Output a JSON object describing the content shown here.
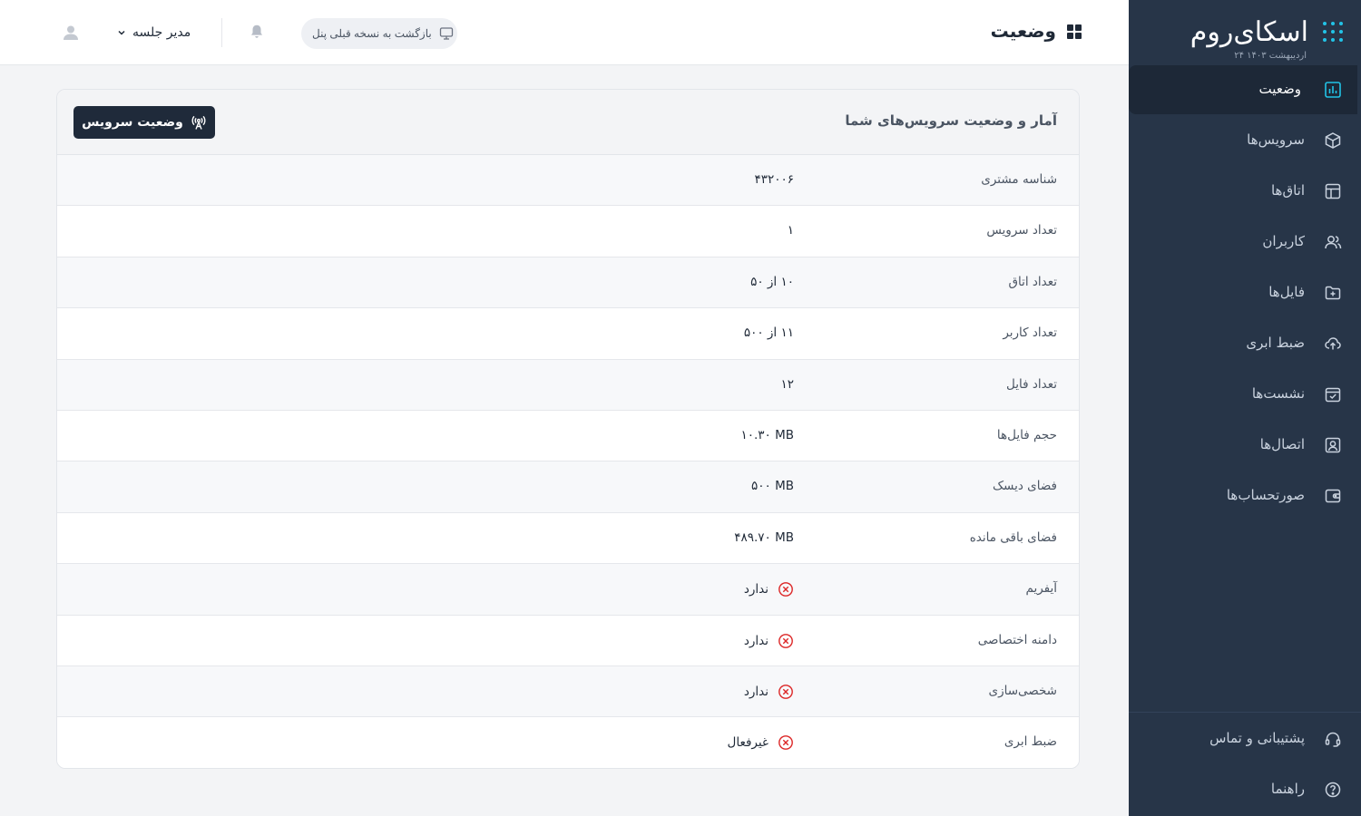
{
  "app": {
    "brand_name": "اسکای‌روم",
    "date": "۲۴ اردیبهشت ۱۴۰۳"
  },
  "sidebar": {
    "items": [
      {
        "label": "وضعیت",
        "icon": "chart-icon",
        "active": true
      },
      {
        "label": "سرویس‌ها",
        "icon": "box-icon"
      },
      {
        "label": "اتاق‌ها",
        "icon": "layout-icon"
      },
      {
        "label": "کاربران",
        "icon": "users-icon"
      },
      {
        "label": "فایل‌ها",
        "icon": "folder-plus-icon"
      },
      {
        "label": "ضبط ابری",
        "icon": "cloud-upload-icon"
      },
      {
        "label": "نشست‌ها",
        "icon": "calendar-check-icon"
      },
      {
        "label": "اتصال‌ها",
        "icon": "contact-icon"
      },
      {
        "label": "صورتحساب‌ها",
        "icon": "wallet-icon"
      }
    ],
    "bottom": [
      {
        "label": "پشتیبانی و تماس",
        "icon": "headset-icon"
      },
      {
        "label": "راهنما",
        "icon": "help-icon"
      }
    ],
    "accent": "#22c3e6",
    "bg": "#273548"
  },
  "topbar": {
    "title": "وضعیت",
    "back_label": "بازگشت به نسخه قبلی پنل",
    "user_label": "مدیر جلسه"
  },
  "card": {
    "title": "آمار و وضعیت سرویس‌های شما",
    "status_button": "وضعیت سرویس",
    "rows": [
      {
        "label": "شناسه مشتری",
        "value": "۴۳۲۰۰۶"
      },
      {
        "label": "تعداد سرویس",
        "value": "۱"
      },
      {
        "label": "تعداد اتاق",
        "value": "۱۰ از ۵۰"
      },
      {
        "label": "تعداد کاربر",
        "value": "۱۱ از ۵۰۰"
      },
      {
        "label": "تعداد فایل",
        "value": "۱۲"
      },
      {
        "label": "حجم فایل‌ها",
        "value": "۱۰.۳۰ MB"
      },
      {
        "label": "فضای دیسک",
        "value": "۵۰۰ MB"
      },
      {
        "label": "فضای باقی مانده",
        "value": "۴۸۹.۷۰ MB"
      },
      {
        "label": "آیفریم",
        "value": "ندارد",
        "status": "no"
      },
      {
        "label": "دامنه اختصاصی",
        "value": "ندارد",
        "status": "no"
      },
      {
        "label": "شخصی‌سازی",
        "value": "ندارد",
        "status": "no"
      },
      {
        "label": "ضبط ابری",
        "value": "غیرفعال",
        "status": "no"
      }
    ]
  },
  "colors": {
    "danger": "#dc2626",
    "dark_button": "#1f2a3a"
  }
}
